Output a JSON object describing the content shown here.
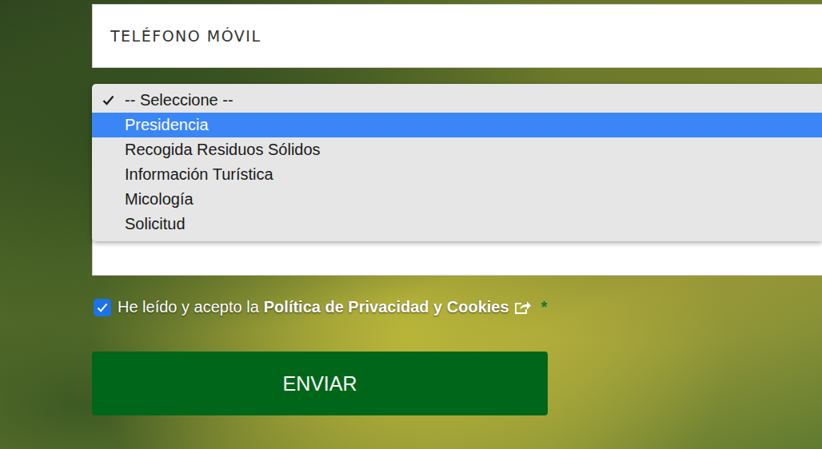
{
  "phone_field": {
    "placeholder": "TELÉFONO MÓVIL"
  },
  "select": {
    "options": [
      {
        "label": "-- Seleccione --",
        "checked": true,
        "selected": false
      },
      {
        "label": "Presidencia",
        "checked": false,
        "selected": true
      },
      {
        "label": "Recogida Residuos Sólidos",
        "checked": false,
        "selected": false
      },
      {
        "label": "Información Turística",
        "checked": false,
        "selected": false
      },
      {
        "label": "Micología",
        "checked": false,
        "selected": false
      },
      {
        "label": "Solicitud",
        "checked": false,
        "selected": false
      }
    ]
  },
  "privacy": {
    "checked": true,
    "prefix": "He leído y acepto la",
    "link": "Política de Privacidad y Cookies",
    "required": "*"
  },
  "submit": {
    "label": "ENVIAR"
  }
}
